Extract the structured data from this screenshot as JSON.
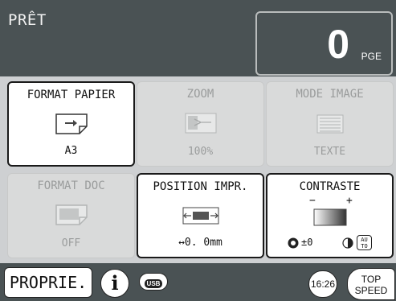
{
  "header": {
    "status": "PRÊT",
    "counter_value": "0",
    "counter_unit": "PGE"
  },
  "tiles": [
    {
      "title": "FORMAT PAPIER",
      "value": "A3",
      "state": "active",
      "icon": "paper-size-icon"
    },
    {
      "title": "ZOOM",
      "value": "100%",
      "state": "dim",
      "icon": "zoom-icon"
    },
    {
      "title": "MODE IMAGE",
      "value": "TEXTE",
      "state": "dim",
      "icon": "text-mode-icon"
    },
    {
      "title": "FORMAT DOC",
      "value": "OFF",
      "state": "dim",
      "icon": "doc-size-icon"
    },
    {
      "title": "POSITION IMPR.",
      "value": "↔0. 0mm",
      "state": "active",
      "icon": "print-position-icon"
    },
    {
      "title": "CONTRASTE",
      "state": "active",
      "icon": "contrast-gradient-icon",
      "minus": "−",
      "plus": "+",
      "density": "±0",
      "auto_label": "AU\nTO"
    }
  ],
  "bottom": {
    "properties_label": "PROPRIE.",
    "info_label": "i",
    "usb_label": "USB",
    "clock": "16:26",
    "top_speed": [
      "TOP",
      "SPEED"
    ]
  },
  "colors": {
    "background": "#4a5254",
    "panel": "#ced0d2",
    "tile_active": "#ffffff",
    "tile_dim": "#d9dada"
  }
}
